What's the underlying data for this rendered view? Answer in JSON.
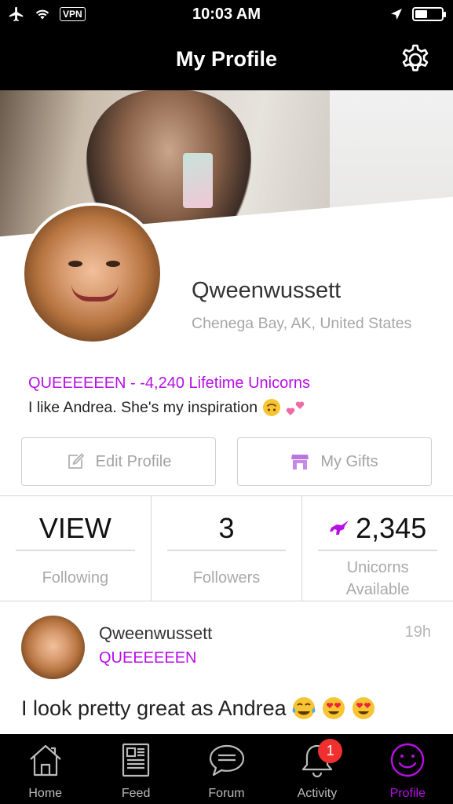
{
  "status_bar": {
    "vpn": "VPN",
    "time": "10:03 AM",
    "battery_level": 0.48
  },
  "header": {
    "title": "My Profile"
  },
  "profile": {
    "username": "Qweenwussett",
    "location": "Chenega Bay, AK, United States",
    "tagline": "QUEEEEEEN - -4,240 Lifetime Unicorns",
    "bio": "I like Andrea. She's my inspiration"
  },
  "actions": {
    "edit_profile": "Edit Profile",
    "my_gifts": "My Gifts"
  },
  "stats": {
    "following": {
      "value": "VIEW",
      "label": "Following"
    },
    "followers": {
      "value": "3",
      "label": "Followers"
    },
    "unicorns": {
      "value": "2,345",
      "label_line1": "Unicorns",
      "label_line2": "Available"
    }
  },
  "post": {
    "username": "Qweenwussett",
    "time": "19h",
    "tag": "QUEEEEEEN",
    "text": "I look pretty great as Andrea"
  },
  "tabs": [
    {
      "label": "Home",
      "icon": "home-icon"
    },
    {
      "label": "Feed",
      "icon": "feed-icon"
    },
    {
      "label": "Forum",
      "icon": "chat-bubble-icon"
    },
    {
      "label": "Activity",
      "icon": "bell-icon",
      "badge": "1"
    },
    {
      "label": "Profile",
      "icon": "smiley-icon",
      "active": true
    }
  ],
  "colors": {
    "accent": "#b70fe6",
    "badge": "#f0302f",
    "bar_bg": "#000000"
  }
}
